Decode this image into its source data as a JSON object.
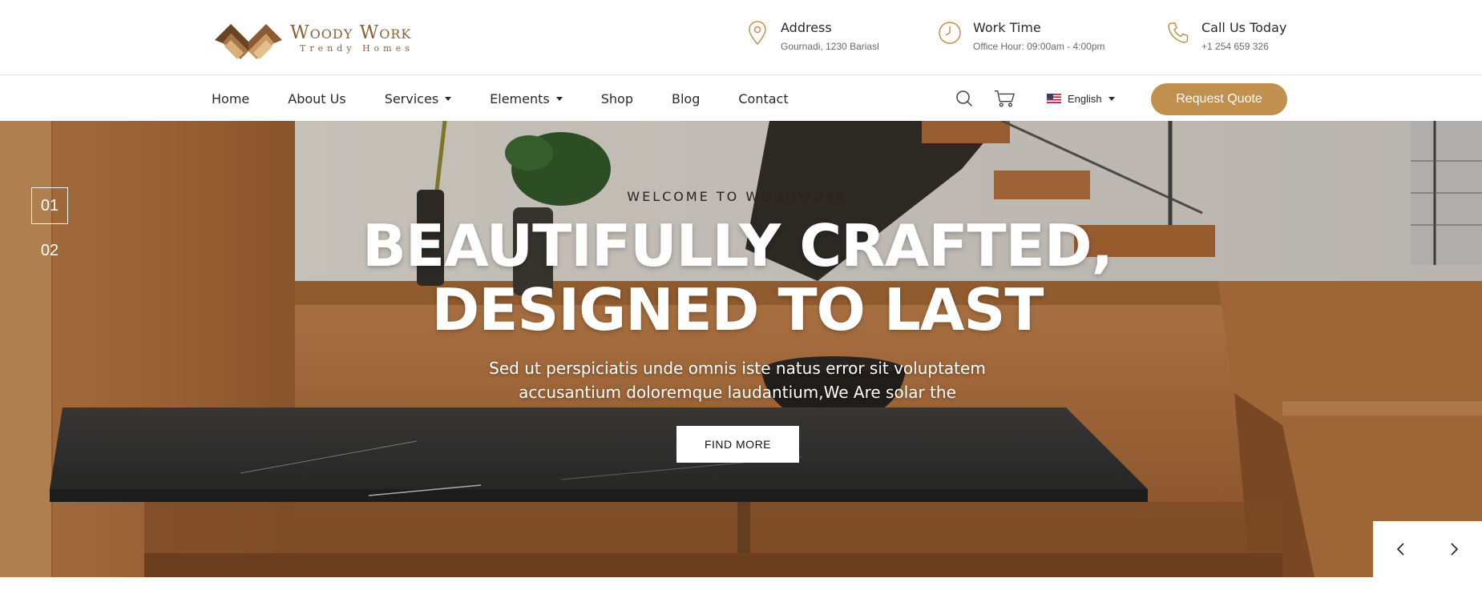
{
  "brand": {
    "name": "Woody Work",
    "tagline": "Trendy Homes",
    "color": "#8a6238"
  },
  "header_info": [
    {
      "icon": "location-pin-icon",
      "title": "Address",
      "subtitle": "Gournadi, 1230 Bariasl"
    },
    {
      "icon": "clock-icon",
      "title": "Work Time",
      "subtitle": "Office Hour: 09:00am - 4:00pm"
    },
    {
      "icon": "phone-icon",
      "title": "Call Us Today",
      "subtitle": "+1 254 659 326"
    }
  ],
  "nav": {
    "items": [
      {
        "label": "Home",
        "dropdown": false
      },
      {
        "label": "About Us",
        "dropdown": false
      },
      {
        "label": "Services",
        "dropdown": true
      },
      {
        "label": "Elements",
        "dropdown": true
      },
      {
        "label": "Shop",
        "dropdown": false
      },
      {
        "label": "Blog",
        "dropdown": false
      },
      {
        "label": "Contact",
        "dropdown": false
      }
    ],
    "language": "English",
    "quote_button": "Request Quote"
  },
  "hero": {
    "slides": [
      "01",
      "02"
    ],
    "active_slide": "01",
    "welcome": "WELCOME TO WOODWORK",
    "headline_line1": "BEAUTIFULLY CRAFTED,",
    "headline_line2": "DESIGNED TO LAST",
    "subtext_line1": "Sed ut perspiciatis unde omnis iste natus error sit voluptatem",
    "subtext_line2": "accusantium doloremque laudantium,We Are solar the",
    "button": "FIND MORE"
  },
  "colors": {
    "accent": "#c1904f",
    "text": "#2a2a2a",
    "wood": "#b97a45"
  }
}
